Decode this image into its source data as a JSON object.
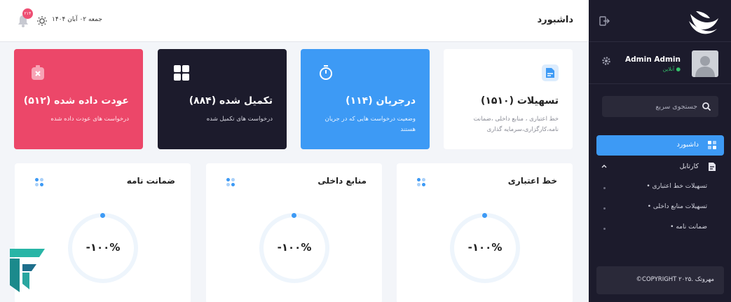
{
  "topbar": {
    "title": "داشبورد",
    "date": "جمعه ۰۲ آبان ۱۴۰۴",
    "notification_count": "۲۱۴"
  },
  "sidebar": {
    "user": {
      "name": "Admin Admin",
      "status": "آنلاین"
    },
    "search_placeholder": "جستجوی سریع",
    "nav": [
      {
        "label": "داشبورد",
        "icon": "grid-icon",
        "active": true
      },
      {
        "label": "کارتابل",
        "icon": "document-icon",
        "expanded": true
      }
    ],
    "subnav": [
      {
        "label": "تسهیلات خط اعتباری"
      },
      {
        "label": "تسهیلات منابع داخلی"
      },
      {
        "label": "ضمانت نامه"
      }
    ],
    "copyright": "مهروتک .COPYRIGHT ۲۰۲۵©"
  },
  "cards": [
    {
      "title": "تسهیلات (۱۵۱۰)",
      "desc": "خط اعتباری ، منابع داخلی ،ضمانت نامه،کارگزاری،سرمایه گذاری",
      "color": "#ffffff"
    },
    {
      "title": "درجریان (۱۱۴)",
      "desc": "وضعیت درخواست هایی که در جریان هستند",
      "color": "#3d9af5"
    },
    {
      "title": "تکمیل شده (۸۸۴)",
      "desc": "درخواست های تکمیل شده",
      "color": "#1c1b2c"
    },
    {
      "title": "عودت داده شده (۵۱۲)",
      "desc": "درخواست های عودت داده شده",
      "color": "#ec4769"
    }
  ],
  "panels": [
    {
      "title": "خط اعتباری",
      "value": "-۱۰۰%"
    },
    {
      "title": "منابع داخلی",
      "value": "-۱۰۰%"
    },
    {
      "title": "ضمانت نامه",
      "value": "-۱۰۰%"
    }
  ],
  "colors": {
    "accent": "#3d9af5",
    "sidebar": "#1c1b2c",
    "danger": "#ec4769",
    "online": "#35c46b"
  }
}
